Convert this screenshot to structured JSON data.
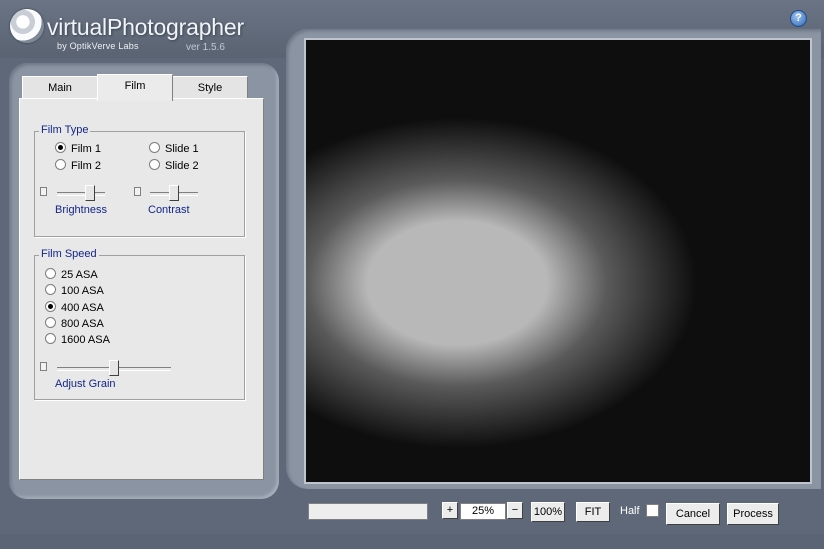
{
  "header": {
    "title": "virtualPhotographer",
    "byline": "by OptikVerve Labs",
    "version": "ver 1.5.6",
    "help_icon": "?"
  },
  "tabs": [
    {
      "label": "Main",
      "active": false
    },
    {
      "label": "Film",
      "active": true
    },
    {
      "label": "Style",
      "active": false
    }
  ],
  "film_type": {
    "title": "Film Type",
    "options": [
      {
        "label": "Film 1",
        "selected": true
      },
      {
        "label": "Slide 1",
        "selected": false
      },
      {
        "label": "Film 2",
        "selected": false
      },
      {
        "label": "Slide 2",
        "selected": false
      }
    ],
    "brightness_label": "Brightness",
    "contrast_label": "Contrast"
  },
  "film_speed": {
    "title": "Film Speed",
    "options": [
      {
        "label": "25 ASA",
        "selected": false
      },
      {
        "label": "100 ASA",
        "selected": false
      },
      {
        "label": "400 ASA",
        "selected": true
      },
      {
        "label": "800 ASA",
        "selected": false
      },
      {
        "label": "1600 ASA",
        "selected": false
      }
    ],
    "grain_label": "Adjust Grain"
  },
  "toolbar": {
    "zoom_in_icon": "+",
    "zoom_value": "25%",
    "zoom_out_icon": "−",
    "hundred_label": "100%",
    "fit_label": "FIT",
    "half_label": "Half",
    "cancel_label": "Cancel",
    "process_label": "Process"
  },
  "colors": {
    "background": "#5e6878",
    "frame": "#8a94a3",
    "panel": "#e8e8e8",
    "label_blue": "#13268a"
  }
}
